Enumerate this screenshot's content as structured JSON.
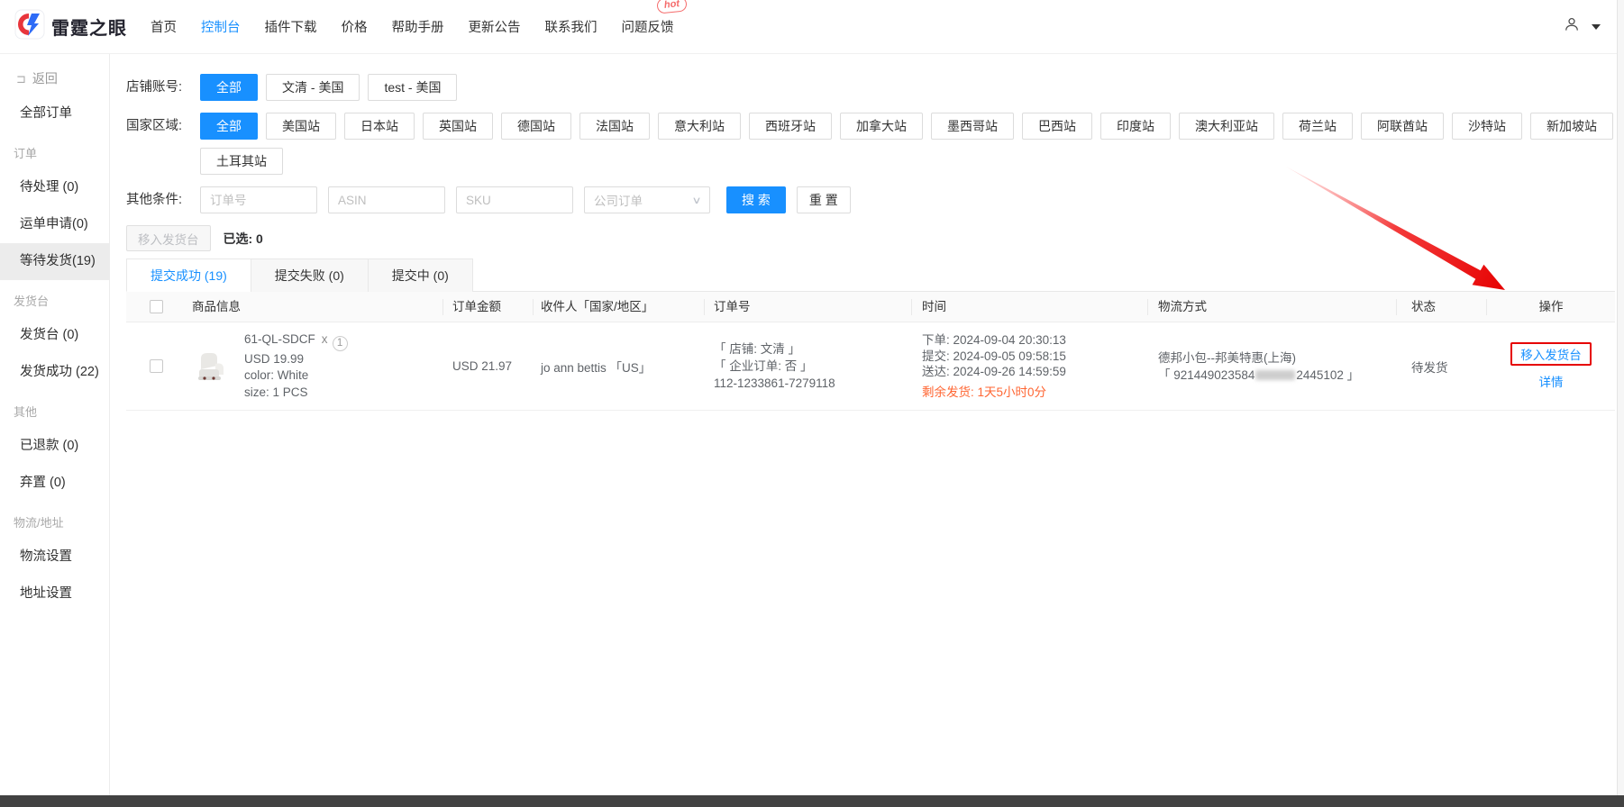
{
  "colors": {
    "primary": "#1890ff",
    "warning": "#ff6633",
    "annotation_red": "#e60202",
    "hot_badge": "#f56c6c"
  },
  "header": {
    "logo_text": "雷霆之眼",
    "hot_badge": "hot",
    "nav": [
      {
        "label": "首页"
      },
      {
        "label": "控制台",
        "active": true
      },
      {
        "label": "插件下载"
      },
      {
        "label": "价格"
      },
      {
        "label": "帮助手册"
      },
      {
        "label": "更新公告"
      },
      {
        "label": "联系我们"
      },
      {
        "label": "问题反馈"
      }
    ]
  },
  "sidebar": {
    "items": [
      {
        "type": "back",
        "label": "返回"
      },
      {
        "type": "item",
        "label": "全部订单"
      },
      {
        "type": "section",
        "label": "订单"
      },
      {
        "type": "item",
        "label": "待处理 (0)"
      },
      {
        "type": "item",
        "label": "运单申请(0)"
      },
      {
        "type": "item",
        "label": "等待发货(19)",
        "active": true
      },
      {
        "type": "section",
        "label": "发货台"
      },
      {
        "type": "item",
        "label": "发货台 (0)"
      },
      {
        "type": "item",
        "label": "发货成功 (22)"
      },
      {
        "type": "section",
        "label": "其他"
      },
      {
        "type": "item",
        "label": "已退款 (0)"
      },
      {
        "type": "item",
        "label": "弃置 (0)"
      },
      {
        "type": "section",
        "label": "物流/地址"
      },
      {
        "type": "item",
        "label": "物流设置"
      },
      {
        "type": "item",
        "label": "地址设置"
      }
    ]
  },
  "filters": {
    "shop": {
      "label": "店铺账号:",
      "options": [
        {
          "label": "全部",
          "active": true
        },
        {
          "label": "文清 - 美国"
        },
        {
          "label": "test - 美国"
        }
      ]
    },
    "country": {
      "label": "国家区域:",
      "options": [
        {
          "label": "全部",
          "active": true
        },
        {
          "label": "美国站"
        },
        {
          "label": "日本站"
        },
        {
          "label": "英国站"
        },
        {
          "label": "德国站"
        },
        {
          "label": "法国站"
        },
        {
          "label": "意大利站"
        },
        {
          "label": "西班牙站"
        },
        {
          "label": "加拿大站"
        },
        {
          "label": "墨西哥站"
        },
        {
          "label": "巴西站"
        },
        {
          "label": "印度站"
        },
        {
          "label": "澳大利亚站"
        },
        {
          "label": "荷兰站"
        },
        {
          "label": "阿联酋站"
        },
        {
          "label": "沙特站"
        },
        {
          "label": "新加坡站"
        },
        {
          "label": "土耳其站"
        }
      ]
    },
    "other": {
      "label": "其他条件:",
      "order_no_placeholder": "订单号",
      "asin_placeholder": "ASIN",
      "sku_placeholder": "SKU",
      "company_order_select": "公司订单",
      "search_label": "搜 索",
      "reset_label": "重 置"
    }
  },
  "toolbar": {
    "move_to_ship_label": "移入发货台",
    "selected_label": "已选: 0"
  },
  "tabs": [
    {
      "label": "提交成功 (19)",
      "active": true
    },
    {
      "label": "提交失败 (0)"
    },
    {
      "label": "提交中 (0)"
    }
  ],
  "table": {
    "columns": [
      "商品信息",
      "订单金额",
      "收件人「国家/地区」",
      "订单号",
      "时间",
      "物流方式",
      "状态",
      "操作"
    ],
    "row": {
      "product": {
        "sku": "61-QL-SDCF",
        "times_symbol": "x",
        "quantity": "1",
        "price": "USD 19.99",
        "color_line": "color:  White",
        "size_line": "size:  1 PCS"
      },
      "amount": "USD 21.97",
      "recipient": "jo ann bettis 「US」",
      "order_info_lines": [
        "「 店铺: 文清 」",
        "「 企业订单: 否 」",
        "112-1233861-7279118"
      ],
      "time_lines": [
        "下单: 2024-09-04 20:30:13",
        "提交: 2024-09-05 09:58:15",
        "送达: 2024-09-26 14:59:59"
      ],
      "remaining_line": "剩余发货: 1天5小时0分",
      "logistics_method": "德邦小包--邦美特惠(上海)",
      "tracking_prefix": "「 921449023584",
      "tracking_suffix": "2445102 」",
      "status": "待发货",
      "action_move": "移入发货台",
      "action_detail": "详情"
    }
  }
}
